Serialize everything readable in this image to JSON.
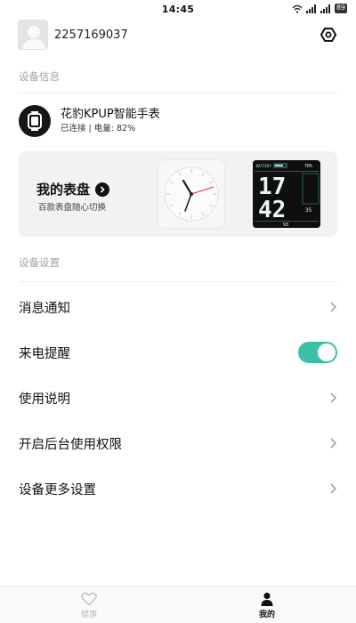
{
  "status_bar": {
    "time": "14:45",
    "battery": "89"
  },
  "profile": {
    "user_id": "2257169037"
  },
  "sections": {
    "device_info": "设备信息",
    "device_settings": "设备设置"
  },
  "device": {
    "name": "花豹KPUP智能手表",
    "status": "已连接 | 电量: 82%"
  },
  "watchface": {
    "title": "我的表盘",
    "subtitle": "百款表盘随心切换",
    "digital_face": {
      "battery_label": "BATTERY",
      "battery": "70%",
      "hour": "17",
      "minute": "42",
      "steps": "93",
      "temp": "35"
    }
  },
  "menu": [
    {
      "label": "消息通知"
    },
    {
      "label": "来电提醒"
    },
    {
      "label": "使用说明"
    },
    {
      "label": "开启后台使用权限"
    },
    {
      "label": "设备更多设置"
    }
  ],
  "bottom_nav": [
    {
      "label": "健康",
      "icon": "heart-icon"
    },
    {
      "label": "我的",
      "icon": "person-icon"
    }
  ],
  "colors": {
    "accent": "#3dbfa7",
    "text": "#111111",
    "muted": "#a3a3a3"
  }
}
